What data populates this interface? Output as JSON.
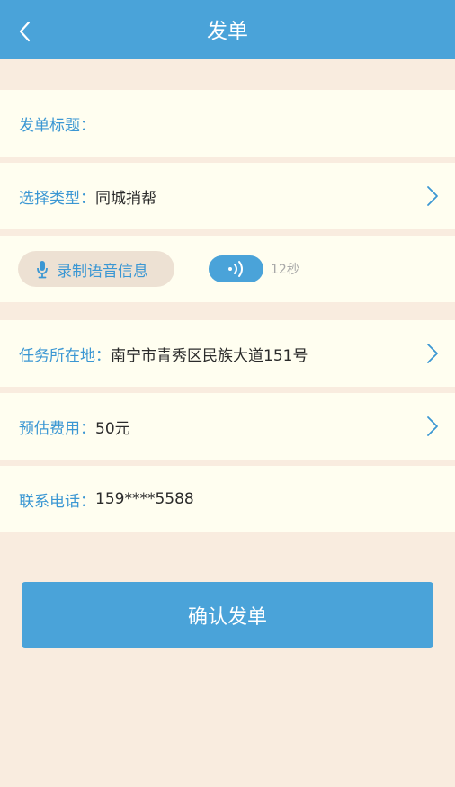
{
  "header": {
    "title": "发单",
    "back_icon": "chevron-left-icon"
  },
  "form": {
    "title_row": {
      "label": "发单标题：",
      "value": ""
    },
    "type_row": {
      "label": "选择类型：",
      "value": "同城捎帮",
      "icon": "chevron-right-icon"
    },
    "voice_row": {
      "record_label": "录制语音信息",
      "record_icon": "microphone-icon",
      "play_icon": "sound-wave-icon",
      "duration": "12秒"
    },
    "location_row": {
      "label": "任务所在地：",
      "value": "南宁市青秀区民族大道151号",
      "icon": "chevron-right-icon"
    },
    "cost_row": {
      "label": "预估费用：",
      "value": "50元",
      "icon": "chevron-right-icon"
    },
    "phone_row": {
      "label": "联系电话：",
      "value": "159****5588"
    }
  },
  "submit": {
    "label": "确认发单"
  },
  "colors": {
    "accent": "#4aa3d9",
    "background": "#f9ecdf",
    "row_background": "#fffef0",
    "label_text": "#3b97d3"
  }
}
